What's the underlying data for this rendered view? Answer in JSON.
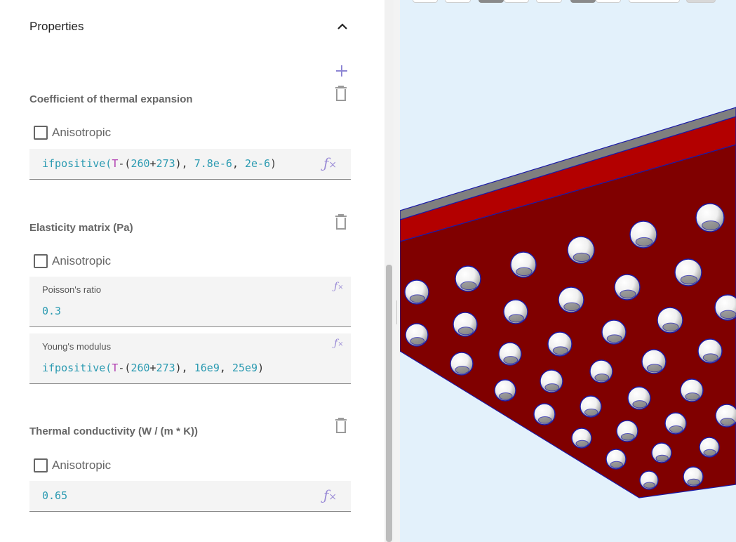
{
  "properties": {
    "title": "Properties",
    "icons": {
      "collapse": "chevron-up-icon",
      "add": "plus-icon"
    }
  },
  "sections": {
    "thermal_expansion": {
      "title": "Coefficient of thermal expansion",
      "anisotropic_label": "Anisotropic",
      "anisotropic_checked": false,
      "value": "ifpositive(T-(260+273), 7.8e-6, 2e-6)"
    },
    "elasticity": {
      "title": "Elasticity matrix (Pa)",
      "anisotropic_label": "Anisotropic",
      "anisotropic_checked": false,
      "poisson": {
        "label": "Poisson's ratio",
        "value": "0.3"
      },
      "young": {
        "label": "Young's modulus",
        "value": "ifpositive(T-(260+273), 16e9, 25e9)"
      }
    },
    "conductivity": {
      "title": "Thermal conductivity (W / (m * K))",
      "anisotropic_label": "Anisotropic",
      "anisotropic_checked": false,
      "value": "0.65"
    }
  },
  "icons": {
    "delete": "trash-icon",
    "formula": "fx-icon",
    "checkbox": "checkbox-icon"
  },
  "colors": {
    "viewport_background": "#e3f1fb",
    "model_face": "#800000",
    "model_edge": "#b30000",
    "model_top": "#7f7f7f",
    "outline": "#1a1aa8",
    "code_number": "#2a9ab1",
    "code_variable": "#b13db1",
    "formula_icon": "#9a8bd6"
  }
}
